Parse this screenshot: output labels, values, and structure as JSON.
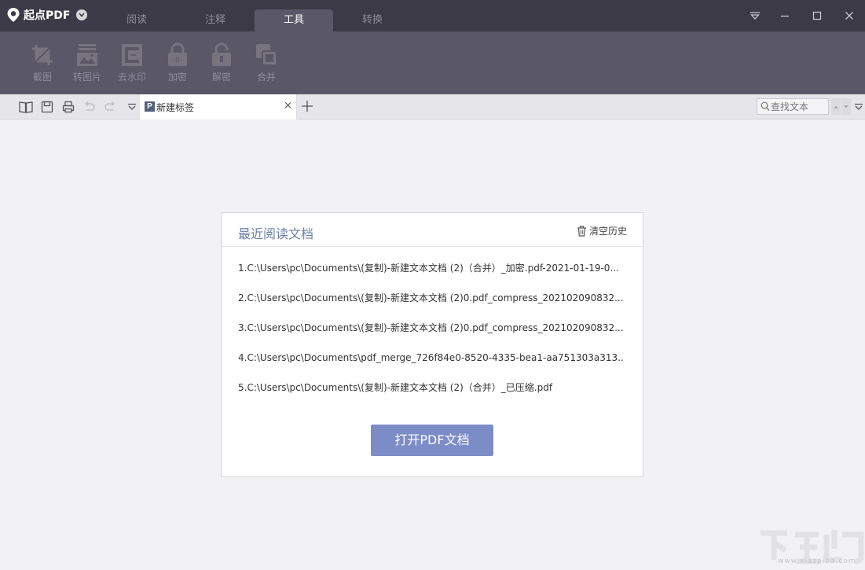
{
  "app": {
    "name": "起点PDF"
  },
  "tabs": [
    {
      "label": "阅读",
      "active": false
    },
    {
      "label": "注释",
      "active": false
    },
    {
      "label": "工具",
      "active": true
    },
    {
      "label": "转换",
      "active": false
    }
  ],
  "toolbar": {
    "tools": [
      {
        "label": "截图",
        "icon": "crop-icon"
      },
      {
        "label": "转图片",
        "icon": "image-convert-icon"
      },
      {
        "label": "去水印",
        "icon": "remove-watermark-icon"
      },
      {
        "label": "加密",
        "icon": "lock-icon"
      },
      {
        "label": "解密",
        "icon": "unlock-icon"
      },
      {
        "label": "合并",
        "icon": "merge-icon"
      }
    ]
  },
  "tabstrip": {
    "doc_tab_label": "新建标签",
    "doc_tab_icon_text": "P",
    "search_placeholder": "查找文本",
    "close_glyph": "×"
  },
  "recent": {
    "title": "最近阅读文档",
    "clear_label": "清空历史",
    "items": [
      "1.C:\\Users\\pc\\Documents\\(复制)-新建文本文档 (2)（合并）_加密.pdf-2021-01-19-0...",
      "2.C:\\Users\\pc\\Documents\\(复制)-新建文本文档 (2)0.pdf_compress_202102090832...",
      "3.C:\\Users\\pc\\Documents\\(复制)-新建文本文档 (2)0.pdf_compress_202102090832...",
      "4.C:\\Users\\pc\\Documents\\pdf_merge_726f84e0-8520-4335-bea1-aa751303a313...",
      "5.C:\\Users\\pc\\Documents\\(复制)-新建文本文档 (2)（合并）_已压缩.pdf"
    ],
    "open_button": "打开PDF文档"
  },
  "watermark": {
    "url": "www.xiazaiba.com"
  },
  "colors": {
    "titlebar": "#3d3a48",
    "toolbar": "#5a5766",
    "accent_button": "#7b8cc7",
    "panel_title": "#6d7fa8"
  }
}
